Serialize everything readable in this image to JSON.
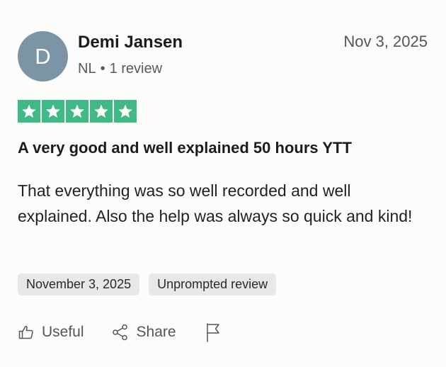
{
  "review": {
    "avatar_initial": "D",
    "author_name": "Demi Jansen",
    "country": "NL",
    "separator": "•",
    "review_count": "1 review",
    "date": "Nov 3, 2025",
    "rating": 5,
    "rating_max": 5,
    "star_color": "#3fb986",
    "title": "A very good and well explained 50 hours YTT",
    "body": "That everything was so well recorded and well explained. Also the help was always so quick and kind!",
    "tags": {
      "experience_date": "November 3, 2025",
      "review_type": "Unprompted review"
    },
    "actions": {
      "useful_label": "Useful",
      "useful_icon": "thumbs-up-icon",
      "share_label": "Share",
      "share_icon": "share-icon",
      "report_icon": "flag-icon"
    }
  }
}
